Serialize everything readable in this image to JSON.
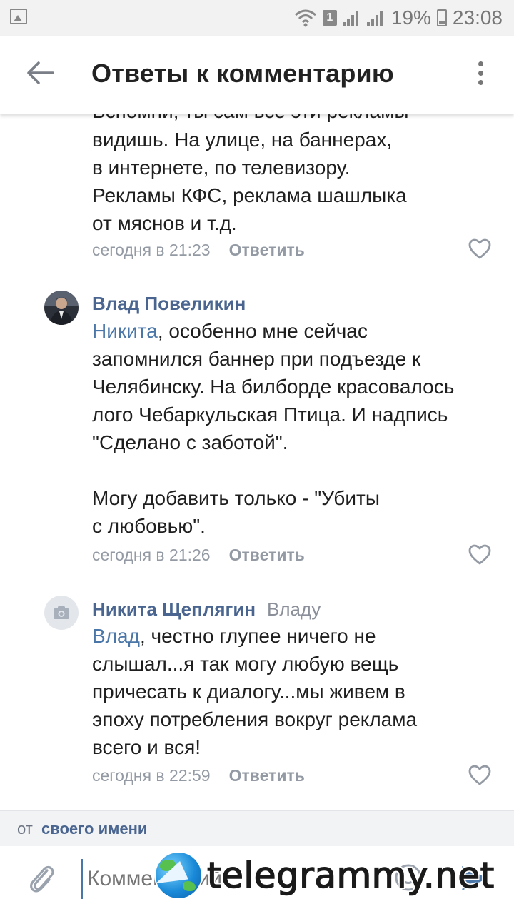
{
  "status_bar": {
    "sim": "1",
    "battery": "19%",
    "time": "23:08"
  },
  "header": {
    "title": "Ответы к комментарию"
  },
  "comments": [
    {
      "text_top": "Вспомни, ты сам все эти рекламы",
      "text": "видишь. На улице, на баннерах,\nв интернете, по телевизору.\nРекламы КФС, реклама шашлыка\nот мяснов и т.д.",
      "time": "сегодня в 21:23",
      "reply": "Ответить"
    },
    {
      "author": "Влад Повеликин",
      "mention": "Никита",
      "text": ", особенно мне сейчас\nзапомнился баннер при подъезде к\nЧелябинску. На билборде красовалось\nлого Чебаркульская Птица. И надпись\n\"Сделано с заботой\".\n\nМогу добавить только - \"Убиты\nс любовью\".",
      "time": "сегодня в 21:26",
      "reply": "Ответить"
    },
    {
      "author": "Никита Щеплягин",
      "to": "Владу",
      "mention": "Влад",
      "text": ", честно глупее ничего не\nслышал...я так могу любую вещь\nпричесать к диалогу...мы живем в\nэпоху потребления вокруг реклама\nвсего и вся!",
      "time": "сегодня в 22:59",
      "reply": "Ответить"
    }
  ],
  "composer": {
    "from_prefix": "от",
    "from_name": "своего имени",
    "placeholder": "Комментарий"
  },
  "watermark": {
    "text": "telegrammy.net"
  },
  "colors": {
    "link": "#4a76a8",
    "author": "#4a6690",
    "meta": "#939aa3"
  }
}
